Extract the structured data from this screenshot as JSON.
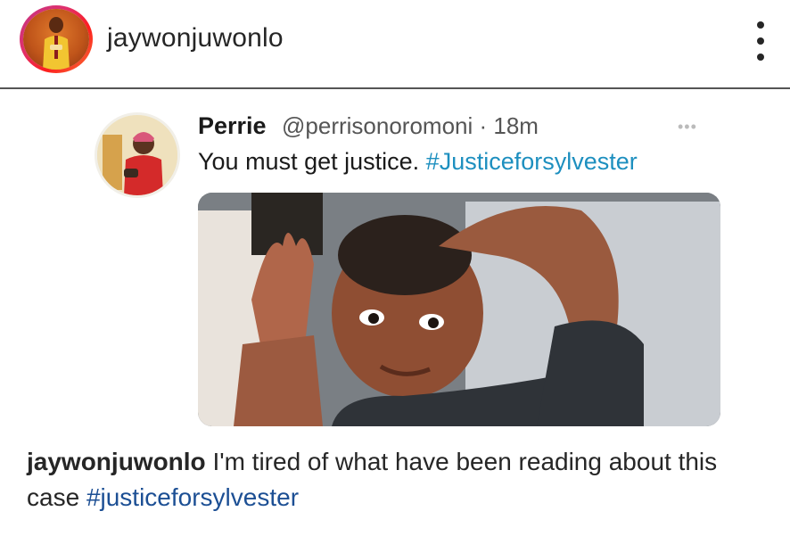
{
  "header": {
    "username": "jaywonjuwonlo",
    "avatar_icon": "profile-avatar",
    "more_icon": "vertical-ellipsis-icon"
  },
  "tweet": {
    "name": "Perrie",
    "handle_time": "@perrisonoromoni · 18m",
    "text": "You must get justice.",
    "hashtag": "#Justiceforsylvester",
    "more_icon": "horizontal-ellipsis-icon",
    "hashtag_color": "#1d8fbf"
  },
  "caption": {
    "username": "jaywonjuwonlo",
    "text": " I'm tired of what have been reading about this case ",
    "hashtag": "#justiceforsylvester",
    "hashtag_color": "#1c4f94"
  },
  "colors": {
    "story_ring": [
      "#c13584",
      "#fd1d1d",
      "#f77737"
    ],
    "divider": "#555555"
  }
}
